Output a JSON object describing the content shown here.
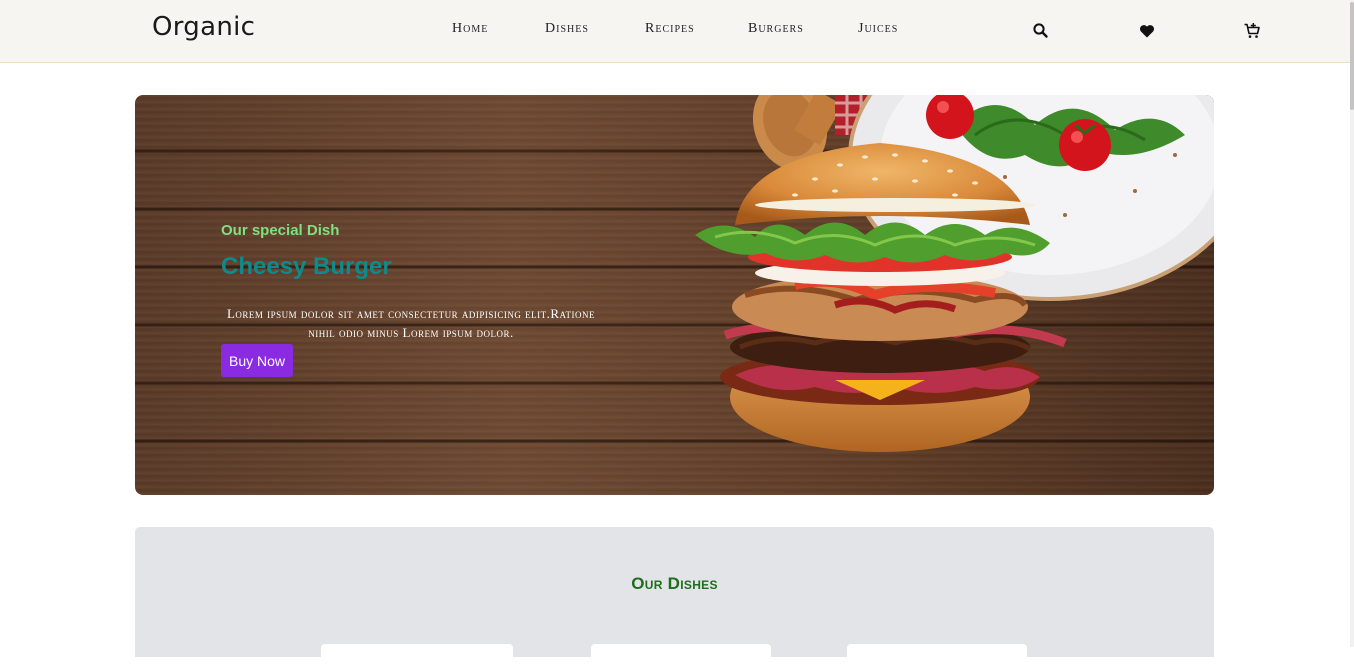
{
  "brand": {
    "logo_text": "Organic"
  },
  "nav": {
    "items": [
      "Home",
      "Dishes",
      "Recipes",
      "Burgers",
      "Juices"
    ]
  },
  "header_icons": [
    "search-icon",
    "heart-icon",
    "cart-icon"
  ],
  "hero": {
    "subtitle": "Our special Dish",
    "title": "Cheesy Burger",
    "description": "Lorem ipsum dolor sit amet consectetur adipisicing elit.Ratione nihil odio minus Lorem ipsum dolor.",
    "button_label": "Buy Now",
    "image": "cheesy-burger-on-wooden-table"
  },
  "dishes_section": {
    "title": "Our Dishes"
  },
  "colors": {
    "header_bg": "#f7f5f1",
    "accent_button": "#8a2be2",
    "subtitle_green": "#7fe07f",
    "title_teal": "#0f8a8a",
    "section_title_green": "#1e6e1e",
    "section_bg": "#e2e4e8"
  }
}
